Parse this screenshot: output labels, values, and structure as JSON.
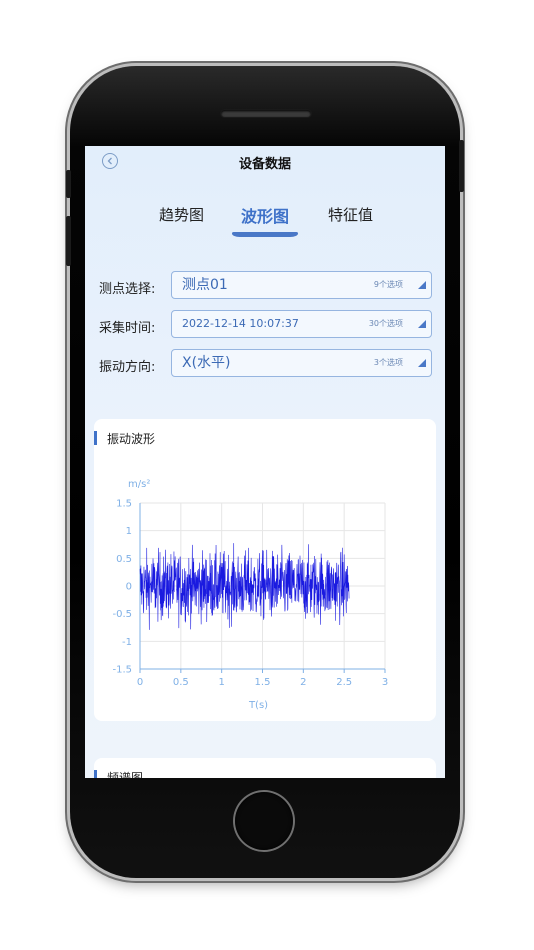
{
  "header": {
    "title": "设备数据",
    "back_icon": "chevron-left-circle-icon"
  },
  "tabs": [
    {
      "label": "趋势图",
      "active": false
    },
    {
      "label": "波形图",
      "active": true
    },
    {
      "label": "特征值",
      "active": false
    }
  ],
  "form": {
    "point": {
      "label": "测点选择:",
      "value": "测点01",
      "hint": "9个选项"
    },
    "time": {
      "label": "采集时间:",
      "value": "2022-12-14 10:07:37",
      "hint": "30个选项"
    },
    "direction": {
      "label": "振动方向:",
      "value": "X(水平)",
      "hint": "3个选项"
    }
  },
  "waveform_card": {
    "title": "振动波形"
  },
  "spectrum_card": {
    "title": "频谱图"
  },
  "colors": {
    "accent": "#3f72c9",
    "series": "#1a1ae0",
    "axis": "#7fb0e6"
  },
  "chart_data": {
    "type": "line",
    "title": "",
    "ylabel": "m/s²",
    "xlabel": "T(s)",
    "xlim": [
      0,
      3
    ],
    "ylim": [
      -1.5,
      1.5
    ],
    "xticks": [
      "0",
      "0.5",
      "1",
      "1.5",
      "2",
      "2.5",
      "3"
    ],
    "yticks": [
      "1.5",
      "1",
      "0.5",
      "0",
      "-0.5",
      "-1",
      "-1.5"
    ],
    "grid": true,
    "series": [
      {
        "x_start": 0,
        "x_end": 2.56,
        "samples": 900,
        "mean": 0,
        "typical_amplitude": 0.3,
        "min": -1.15,
        "max": 1.0
      }
    ]
  }
}
